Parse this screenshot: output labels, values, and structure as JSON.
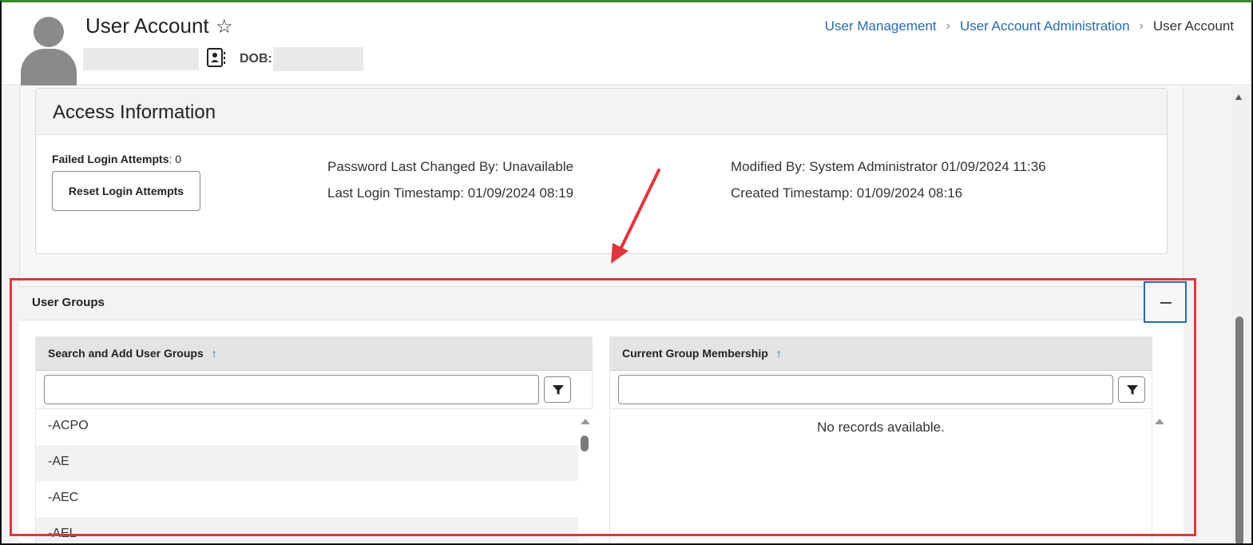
{
  "header": {
    "title": "User Account",
    "dob_label": "DOB:",
    "breadcrumb": {
      "items": [
        "User Management",
        "User Account Administration"
      ],
      "current": "User Account"
    }
  },
  "access": {
    "title": "Access Information",
    "failed_label": "Failed Login Attempts",
    "failed_value": ": 0",
    "reset_label": "Reset Login Attempts",
    "password_changed": "Password Last Changed By: Unavailable",
    "last_login": "Last Login Timestamp: 01/09/2024 08:19",
    "modified_by": "Modified By: System Administrator 01/09/2024 11:36",
    "created": "Created Timestamp: 01/09/2024 08:16"
  },
  "user_groups": {
    "title": "User Groups",
    "search_panel": {
      "header": "Search and Add User Groups",
      "sort_icon": "arrow-up-icon",
      "filter_value": "",
      "rows": [
        "-ACPO",
        "-AE",
        "-AEC",
        "-AEL"
      ]
    },
    "membership_panel": {
      "header": "Current Group Membership",
      "sort_icon": "arrow-up-icon",
      "filter_value": "",
      "empty_text": "No records available."
    }
  },
  "colors": {
    "link": "#2a6aa8",
    "highlight": "#e0363e",
    "top_border": "#3a8a2a"
  }
}
